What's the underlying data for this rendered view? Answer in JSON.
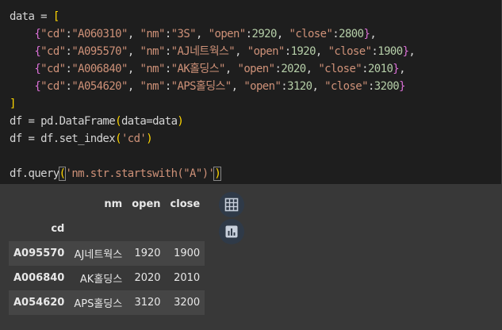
{
  "code_lines": [
    "data = [",
    "    {\"cd\":\"A060310\", \"nm\":\"3S\", \"open\":2920, \"close\":2800},",
    "    {\"cd\":\"A095570\", \"nm\":\"AJ네트웍스\", \"open\":1920, \"close\":1900},",
    "    {\"cd\":\"A006840\", \"nm\":\"AK홀딩스\", \"open\":2020, \"close\":2010},",
    "    {\"cd\":\"A054620\", \"nm\":\"APS홀딩스\", \"open\":3120, \"close\":3200}",
    "]",
    "df = pd.DataFrame(data=data)",
    "df = df.set_index('cd')",
    "",
    "df.query('nm.str.startswith(\"A\")')"
  ],
  "table": {
    "columns": [
      "nm",
      "open",
      "close"
    ],
    "index_name": "cd",
    "rows": [
      {
        "cd": "A095570",
        "nm": "AJ네트웍스",
        "open": "1920",
        "close": "1900"
      },
      {
        "cd": "A006840",
        "nm": "AK홀딩스",
        "open": "2020",
        "close": "2010"
      },
      {
        "cd": "A054620",
        "nm": "APS홀딩스",
        "open": "3120",
        "close": "3200"
      }
    ]
  },
  "buttons": {
    "table_icon": "table-icon",
    "chart_icon": "bar-chart-icon"
  },
  "colors": {
    "editor_bg": "#1e1e1e",
    "output_bg": "#383838",
    "string": "#ce9178",
    "number": "#b5cea8",
    "bracket": "#ffd700"
  }
}
